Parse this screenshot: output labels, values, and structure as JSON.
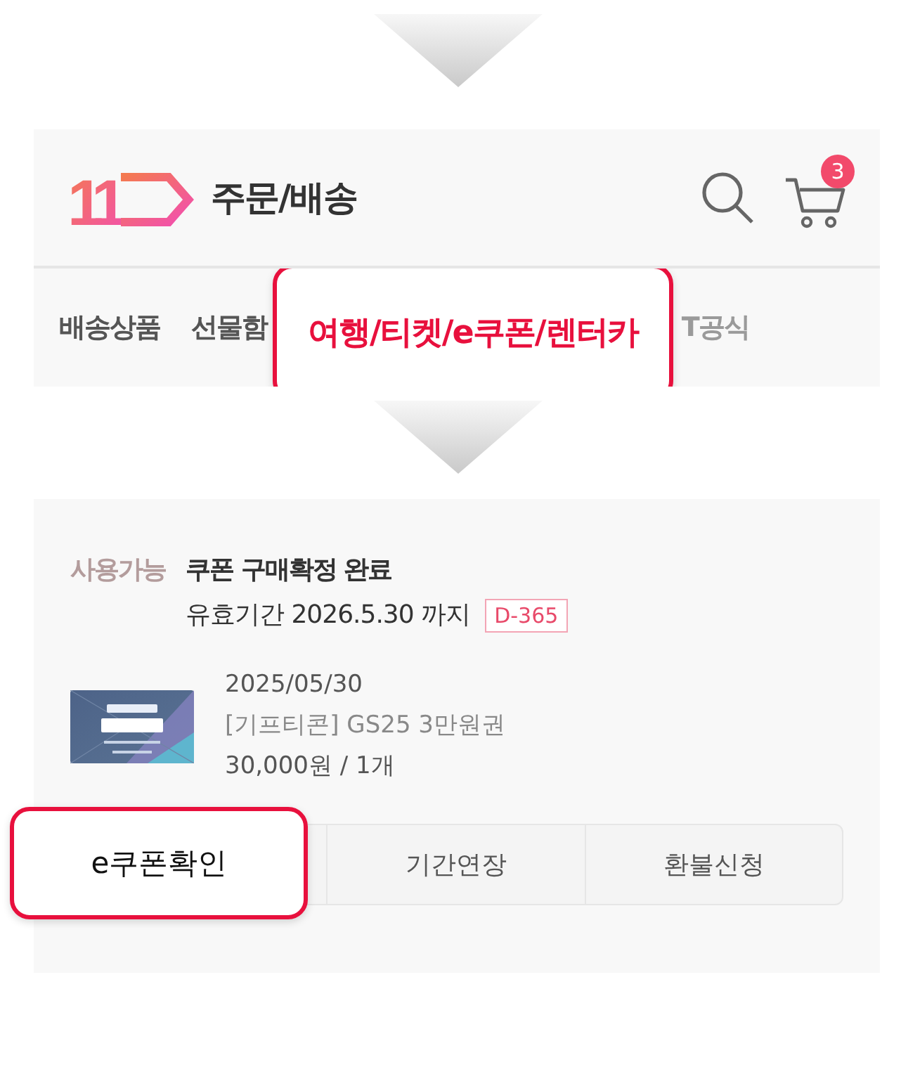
{
  "header": {
    "logo_text": "11",
    "title": "주문/배송",
    "cart_count": "3"
  },
  "tabs": [
    {
      "label": "배송상품",
      "selected": false
    },
    {
      "label": "선물함",
      "selected": false
    },
    {
      "label": "여행/티켓/e쿠폰/렌터카",
      "selected": true
    },
    {
      "label": "T공식",
      "selected": false
    }
  ],
  "order": {
    "status": "사용가능",
    "title": "쿠폰 구매확정 완료",
    "validity": "유효기간 2026.5.30 까지",
    "dday": "D-365",
    "product": {
      "kind": "picture",
      "date": "2025/05/30",
      "name": "[기프티콘] GS25 3만원권",
      "price": "30,000원 / 1개"
    },
    "actions": [
      {
        "label": "e쿠폰확인",
        "highlighted": true
      },
      {
        "label": "기간연장",
        "highlighted": false
      },
      {
        "label": "환불신청",
        "highlighted": false
      }
    ]
  }
}
